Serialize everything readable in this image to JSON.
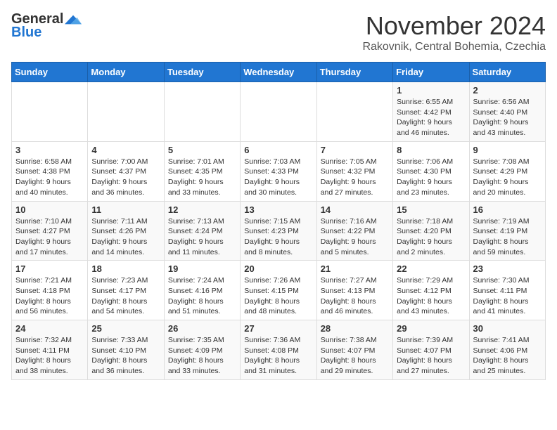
{
  "logo": {
    "general": "General",
    "blue": "Blue"
  },
  "header": {
    "month": "November 2024",
    "location": "Rakovnik, Central Bohemia, Czechia"
  },
  "days_of_week": [
    "Sunday",
    "Monday",
    "Tuesday",
    "Wednesday",
    "Thursday",
    "Friday",
    "Saturday"
  ],
  "weeks": [
    [
      {
        "day": "",
        "info": ""
      },
      {
        "day": "",
        "info": ""
      },
      {
        "day": "",
        "info": ""
      },
      {
        "day": "",
        "info": ""
      },
      {
        "day": "",
        "info": ""
      },
      {
        "day": "1",
        "info": "Sunrise: 6:55 AM\nSunset: 4:42 PM\nDaylight: 9 hours and 46 minutes."
      },
      {
        "day": "2",
        "info": "Sunrise: 6:56 AM\nSunset: 4:40 PM\nDaylight: 9 hours and 43 minutes."
      }
    ],
    [
      {
        "day": "3",
        "info": "Sunrise: 6:58 AM\nSunset: 4:38 PM\nDaylight: 9 hours and 40 minutes."
      },
      {
        "day": "4",
        "info": "Sunrise: 7:00 AM\nSunset: 4:37 PM\nDaylight: 9 hours and 36 minutes."
      },
      {
        "day": "5",
        "info": "Sunrise: 7:01 AM\nSunset: 4:35 PM\nDaylight: 9 hours and 33 minutes."
      },
      {
        "day": "6",
        "info": "Sunrise: 7:03 AM\nSunset: 4:33 PM\nDaylight: 9 hours and 30 minutes."
      },
      {
        "day": "7",
        "info": "Sunrise: 7:05 AM\nSunset: 4:32 PM\nDaylight: 9 hours and 27 minutes."
      },
      {
        "day": "8",
        "info": "Sunrise: 7:06 AM\nSunset: 4:30 PM\nDaylight: 9 hours and 23 minutes."
      },
      {
        "day": "9",
        "info": "Sunrise: 7:08 AM\nSunset: 4:29 PM\nDaylight: 9 hours and 20 minutes."
      }
    ],
    [
      {
        "day": "10",
        "info": "Sunrise: 7:10 AM\nSunset: 4:27 PM\nDaylight: 9 hours and 17 minutes."
      },
      {
        "day": "11",
        "info": "Sunrise: 7:11 AM\nSunset: 4:26 PM\nDaylight: 9 hours and 14 minutes."
      },
      {
        "day": "12",
        "info": "Sunrise: 7:13 AM\nSunset: 4:24 PM\nDaylight: 9 hours and 11 minutes."
      },
      {
        "day": "13",
        "info": "Sunrise: 7:15 AM\nSunset: 4:23 PM\nDaylight: 9 hours and 8 minutes."
      },
      {
        "day": "14",
        "info": "Sunrise: 7:16 AM\nSunset: 4:22 PM\nDaylight: 9 hours and 5 minutes."
      },
      {
        "day": "15",
        "info": "Sunrise: 7:18 AM\nSunset: 4:20 PM\nDaylight: 9 hours and 2 minutes."
      },
      {
        "day": "16",
        "info": "Sunrise: 7:19 AM\nSunset: 4:19 PM\nDaylight: 8 hours and 59 minutes."
      }
    ],
    [
      {
        "day": "17",
        "info": "Sunrise: 7:21 AM\nSunset: 4:18 PM\nDaylight: 8 hours and 56 minutes."
      },
      {
        "day": "18",
        "info": "Sunrise: 7:23 AM\nSunset: 4:17 PM\nDaylight: 8 hours and 54 minutes."
      },
      {
        "day": "19",
        "info": "Sunrise: 7:24 AM\nSunset: 4:16 PM\nDaylight: 8 hours and 51 minutes."
      },
      {
        "day": "20",
        "info": "Sunrise: 7:26 AM\nSunset: 4:15 PM\nDaylight: 8 hours and 48 minutes."
      },
      {
        "day": "21",
        "info": "Sunrise: 7:27 AM\nSunset: 4:13 PM\nDaylight: 8 hours and 46 minutes."
      },
      {
        "day": "22",
        "info": "Sunrise: 7:29 AM\nSunset: 4:12 PM\nDaylight: 8 hours and 43 minutes."
      },
      {
        "day": "23",
        "info": "Sunrise: 7:30 AM\nSunset: 4:11 PM\nDaylight: 8 hours and 41 minutes."
      }
    ],
    [
      {
        "day": "24",
        "info": "Sunrise: 7:32 AM\nSunset: 4:11 PM\nDaylight: 8 hours and 38 minutes."
      },
      {
        "day": "25",
        "info": "Sunrise: 7:33 AM\nSunset: 4:10 PM\nDaylight: 8 hours and 36 minutes."
      },
      {
        "day": "26",
        "info": "Sunrise: 7:35 AM\nSunset: 4:09 PM\nDaylight: 8 hours and 33 minutes."
      },
      {
        "day": "27",
        "info": "Sunrise: 7:36 AM\nSunset: 4:08 PM\nDaylight: 8 hours and 31 minutes."
      },
      {
        "day": "28",
        "info": "Sunrise: 7:38 AM\nSunset: 4:07 PM\nDaylight: 8 hours and 29 minutes."
      },
      {
        "day": "29",
        "info": "Sunrise: 7:39 AM\nSunset: 4:07 PM\nDaylight: 8 hours and 27 minutes."
      },
      {
        "day": "30",
        "info": "Sunrise: 7:41 AM\nSunset: 4:06 PM\nDaylight: 8 hours and 25 minutes."
      }
    ]
  ]
}
